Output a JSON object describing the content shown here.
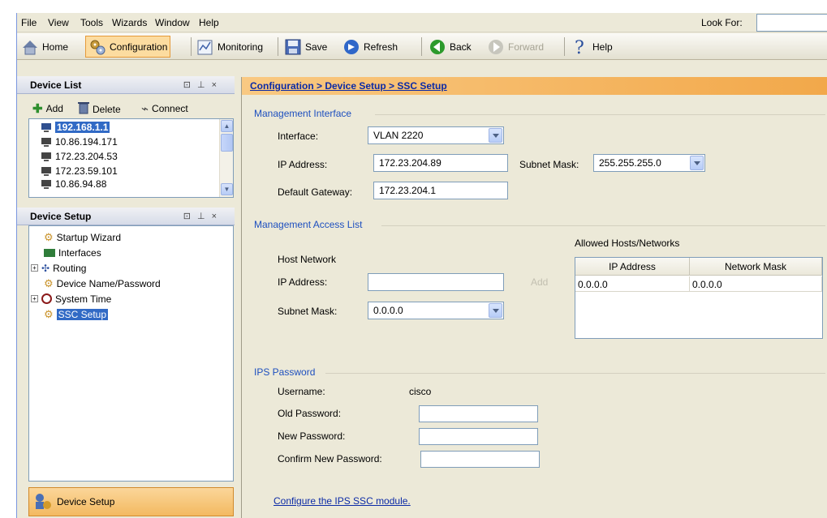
{
  "menubar": {
    "items": [
      "File",
      "View",
      "Tools",
      "Wizards",
      "Window",
      "Help"
    ],
    "look_for_label": "Look For:"
  },
  "toolbar": {
    "home": "Home",
    "configuration": "Configuration",
    "monitoring": "Monitoring",
    "save": "Save",
    "refresh": "Refresh",
    "back": "Back",
    "forward": "Forward",
    "help": "Help"
  },
  "device_list": {
    "title": "Device List",
    "add": "Add",
    "delete": "Delete",
    "connect": "Connect",
    "devices": [
      "192.168.1.1",
      "10.86.194.171",
      "172.23.204.53",
      "172.23.59.101",
      "10.86.94.88"
    ]
  },
  "device_setup": {
    "title": "Device Setup",
    "items": [
      "Startup Wizard",
      "Interfaces",
      "Routing",
      "Device Name/Password",
      "System Time",
      "SSC Setup"
    ]
  },
  "nav": {
    "device_setup_button": "Device Setup"
  },
  "breadcrumb": "Configuration > Device Setup > SSC Setup",
  "mgmt_interface": {
    "title": "Management Interface",
    "interface_label": "Interface:",
    "interface_value": "VLAN 2220",
    "ip_label": "IP Address:",
    "ip_value": "172.23.204.89",
    "subnet_label": "Subnet Mask:",
    "subnet_value": "255.255.255.0",
    "gateway_label": "Default Gateway:",
    "gateway_value": "172.23.204.1"
  },
  "access_list": {
    "title": "Management Access List",
    "host_network": "Host Network",
    "ip_label": "IP Address:",
    "ip_value": "",
    "subnet_label": "Subnet Mask:",
    "subnet_value": "0.0.0.0",
    "add": "Add",
    "allowed_title": "Allowed Hosts/Networks",
    "columns": [
      "IP Address",
      "Network Mask"
    ],
    "rows": [
      [
        "0.0.0.0",
        "0.0.0.0"
      ]
    ]
  },
  "ips_password": {
    "title": "IPS Password",
    "username_label": "Username:",
    "username_value": "cisco",
    "old_label": "Old Password:",
    "new_label": "New Password:",
    "confirm_label": "Confirm New Password:"
  },
  "configure_link": "Configure the IPS SSC module."
}
